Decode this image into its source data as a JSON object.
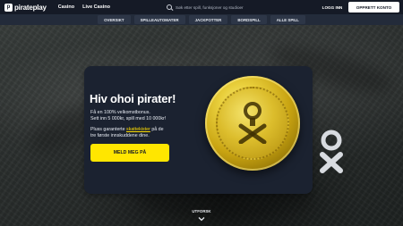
{
  "brand": {
    "logo_text": "pirateplay",
    "logo_glyph": "p"
  },
  "topnav": [
    "Casino",
    "Live Casino"
  ],
  "search": {
    "placeholder": "Søk etter spill, funksjoner og studioer"
  },
  "header_buttons": {
    "login": "LOGG INN",
    "register": "OPPRETT KONTO"
  },
  "categories": [
    "OVERSIKT",
    "SPILLEAUTOMATER",
    "JACKPOTTER",
    "BORDSPILL",
    "ALLE SPILL"
  ],
  "promo": {
    "title": "Hiv ohoi pirater!",
    "line1": "Få en 100% velkomstbonus.",
    "line2": "Sett inn 5 000kr, spill med 10 000kr!",
    "line3_pre": "Pluss garanterte ",
    "line3_link": "skattekister",
    "line3_post": " på de",
    "line4": "tre første innskuddene dine.",
    "cta": "MELD MEG PÅ"
  },
  "explore": "UTFORSK",
  "colors": {
    "topbar": "#151a26",
    "catbar": "#232b3a",
    "card": "#1b2230",
    "accent_yellow": "#ffe600",
    "coin_gold": "#d4b21e"
  },
  "icons": [
    "search-icon",
    "coin-logo-icon",
    "chevron-down-icon"
  ]
}
